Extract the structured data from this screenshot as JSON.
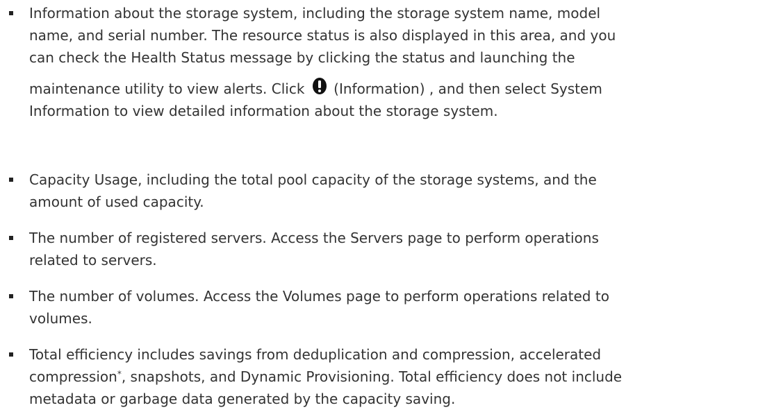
{
  "items": [
    {
      "lines": [
        "Information about the storage system, including the storage system name, model",
        "name, and serial number. The resource status is also displayed in this area, and you",
        "can check the Health Status message by clicking the status and launching the"
      ],
      "line4_before_icon": "maintenance utility to view alerts. Click",
      "icon": "information-icon",
      "line4_after_icon": "(Information) , and then select System",
      "line5": "Information to view detailed information about the storage system."
    },
    {
      "lines": [
        "Capacity Usage, including the total pool capacity of the storage systems, and the",
        "amount of used capacity."
      ]
    },
    {
      "lines": [
        "The number of registered servers. Access the Servers page to perform operations",
        "related to servers."
      ]
    },
    {
      "lines": [
        "The number of volumes. Access the Volumes page to perform operations related to",
        "volumes."
      ]
    },
    {
      "line1": "Total efficiency includes savings from deduplication and compression, accelerated",
      "line2_before_sup": "compression",
      "footnote_mark": "*",
      "line2_after_sup": ", snapshots, and Dynamic Provisioning. Total efficiency does not include",
      "line3": "metadata or garbage data generated by the capacity saving."
    }
  ]
}
